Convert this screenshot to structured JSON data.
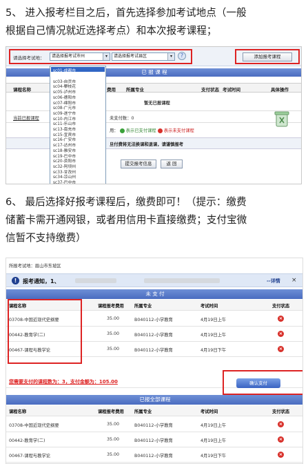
{
  "step5": {
    "line1": "5、 进入报考栏目之后，首先选择参加考试地点（一般",
    "line2": "根据自己情况就近选择考点）和本次报考课程；"
  },
  "step6": {
    "line1": "6、 最后选择好报考课程后，缴费即可！（提示：缴费",
    "line2": "储蓄卡需开通网银，或者用信用卡直接缴费；支付宝微",
    "line3": "信暂不支持缴费）"
  },
  "shot1": {
    "exam_site_label": "请选择考试地：",
    "city_select": "请选择报考试市州",
    "district_select": "请选择报考试县区",
    "add_course_button": "添加报考课程",
    "selected_header": "已 报 课 程",
    "columns": [
      "课程名称",
      "费用",
      "所属专业",
      "支付状态",
      "考试时间",
      "具体操作"
    ],
    "no_course_text": "暂无已报课程",
    "cancel_link": "当前已报课程",
    "unpaid_text": "未支付数：0",
    "legend_prefix": "用：",
    "legend_paid": "表示已支付课程",
    "legend_unpaid": "表示未支付课程",
    "warning": "旦付费将无法换课和退课，请谨慎报考",
    "submit_button": "提交报考信息",
    "back_button": "返 回",
    "dropdown_items": [
      "sc01-成都市",
      "sc03-自贡市",
      "sc04-攀枝花",
      "sc05-泸州市",
      "sc06-德阳市",
      "sc07-绵阳市",
      "sc08-广元市",
      "sc09-遂宁市",
      "sc10-内江市",
      "sc11-乐山市",
      "sc13-南充市",
      "sc15-宜宾市",
      "sc16-广安市",
      "sc17-达州市",
      "sc18-雅安市",
      "sc19-巴中市",
      "sc20-资阳市",
      "sc32-阿坝州",
      "sc33-甘孜州",
      "sc34-凉山州",
      "sc37-巴中市"
    ]
  },
  "shot2": {
    "site_line": "所报考试地：眉山市东坡区",
    "notice_text": "报考通知，1、",
    "detail_link": "--详情",
    "close_x": "×",
    "unpaid_header": "未 支 付",
    "all_header": "已报全部课程",
    "columns": [
      "课程名称",
      "课程报考费用",
      "所属专业",
      "考试时间",
      "支付状态"
    ],
    "unpaid_rows": [
      {
        "name": "03708-中国近现代史纲要",
        "fee": "35.00",
        "major": "B040112-小学教育",
        "time": "4月19日上午"
      },
      {
        "name": "00442-教育学(二)",
        "fee": "35.00",
        "major": "B040112-小学教育",
        "time": "4月19日上午"
      },
      {
        "name": "00467-课程与教学论",
        "fee": "35.00",
        "major": "B040112-小学教育",
        "time": "4月19日下午"
      }
    ],
    "summary": "您需要支付的课程数为：3，支付金额为：105.00",
    "pay_button": "确认支付",
    "all_rows": [
      {
        "name": "03708-中国近现代史纲要",
        "fee": "35.00",
        "major": "B040112-小学教育",
        "time": "4月19日上午"
      },
      {
        "name": "00442-教育学(二)",
        "fee": "35.00",
        "major": "B040112-小学教育",
        "time": "4月19日上午"
      },
      {
        "name": "00467-课程与教学论",
        "fee": "35.00",
        "major": "B040112-小学教育",
        "time": "4月19日下午"
      }
    ]
  },
  "colors": {
    "accent_blue": "#4a6cc0",
    "highlight_red": "#d22222",
    "x_red": "#d8302a"
  }
}
